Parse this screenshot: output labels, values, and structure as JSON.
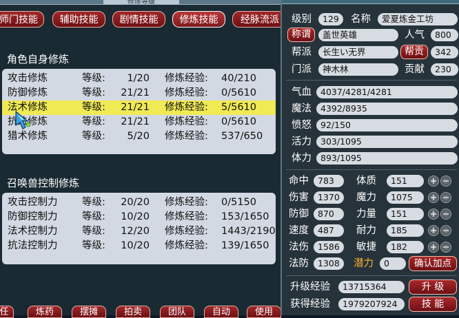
{
  "left": {
    "title": "修炼等级",
    "tabs": [
      "师门技能",
      "辅助技能",
      "剧情技能",
      "修炼技能",
      "经脉流派"
    ],
    "active_tab": 3,
    "self_section": {
      "title": "角色自身修炼",
      "level_label": "等级:",
      "exp_label": "修炼经验:",
      "rows": [
        {
          "name": "攻击修炼",
          "level": "1/20",
          "exp": "40/210"
        },
        {
          "name": "防御修炼",
          "level": "21/21",
          "exp": "0/5610"
        },
        {
          "name": "法术修炼",
          "level": "21/21",
          "exp": "5/5610",
          "selected": true
        },
        {
          "name": "抗法修炼",
          "level": "21/21",
          "exp": "0/5610"
        },
        {
          "name": "猎术修炼",
          "level": "5/20",
          "exp": "537/650"
        }
      ]
    },
    "pet_section": {
      "title": "召唤兽控制修炼",
      "level_label": "等级:",
      "exp_label": "修炼经验:",
      "rows": [
        {
          "name": "攻击控制力",
          "level": "20/20",
          "exp": "0/5150"
        },
        {
          "name": "防御控制力",
          "level": "10/20",
          "exp": "153/1650"
        },
        {
          "name": "法术控制力",
          "level": "12/20",
          "exp": "1443/2190"
        },
        {
          "name": "抗法控制力",
          "level": "10/20",
          "exp": "139/1650"
        }
      ]
    },
    "bottom_tabs": [
      "任",
      "炼药",
      "摆摊",
      "拍卖",
      "团队",
      "自动",
      "使用"
    ]
  },
  "right": {
    "title": "人物状态",
    "level_label": "级别",
    "level": "129",
    "name_label": "名称",
    "name": "爱夏炼金工坊",
    "title_button": "称谓",
    "title_value": "盖世英雄",
    "popularity_label": "人气",
    "popularity": "800",
    "faction_label": "帮派",
    "faction": "长生い无界",
    "contrib_button": "帮贡",
    "contrib": "342",
    "sect_label": "门派",
    "sect": "神木林",
    "devotion_label": "贡献",
    "devotion": "230",
    "vitals": [
      {
        "label": "气血",
        "value": "4037/4281/4281"
      },
      {
        "label": "魔法",
        "value": "4392/8935"
      },
      {
        "label": "愤怒",
        "value": "92/150"
      },
      {
        "label": "活力",
        "value": "303/1095"
      },
      {
        "label": "体力",
        "value": "893/1095"
      }
    ],
    "stats_left": [
      {
        "label": "命中",
        "value": "783"
      },
      {
        "label": "伤害",
        "value": "1370"
      },
      {
        "label": "防御",
        "value": "870"
      },
      {
        "label": "速度",
        "value": "487"
      },
      {
        "label": "法伤",
        "value": "1586"
      },
      {
        "label": "法防",
        "value": "1308"
      }
    ],
    "stats_right": [
      {
        "label": "体质",
        "value": "151"
      },
      {
        "label": "魔力",
        "value": "1075"
      },
      {
        "label": "力量",
        "value": "151"
      },
      {
        "label": "耐力",
        "value": "185"
      },
      {
        "label": "敏捷",
        "value": "182"
      }
    ],
    "potential_label": "潜力",
    "potential": "0",
    "confirm_button": "确认加点",
    "upgrade_exp_label": "升级经验",
    "upgrade_exp": "13715364",
    "upgrade_button": "升 级",
    "gained_exp_label": "获得经验",
    "gained_exp": "1979207924",
    "skills_button": "技 能"
  }
}
